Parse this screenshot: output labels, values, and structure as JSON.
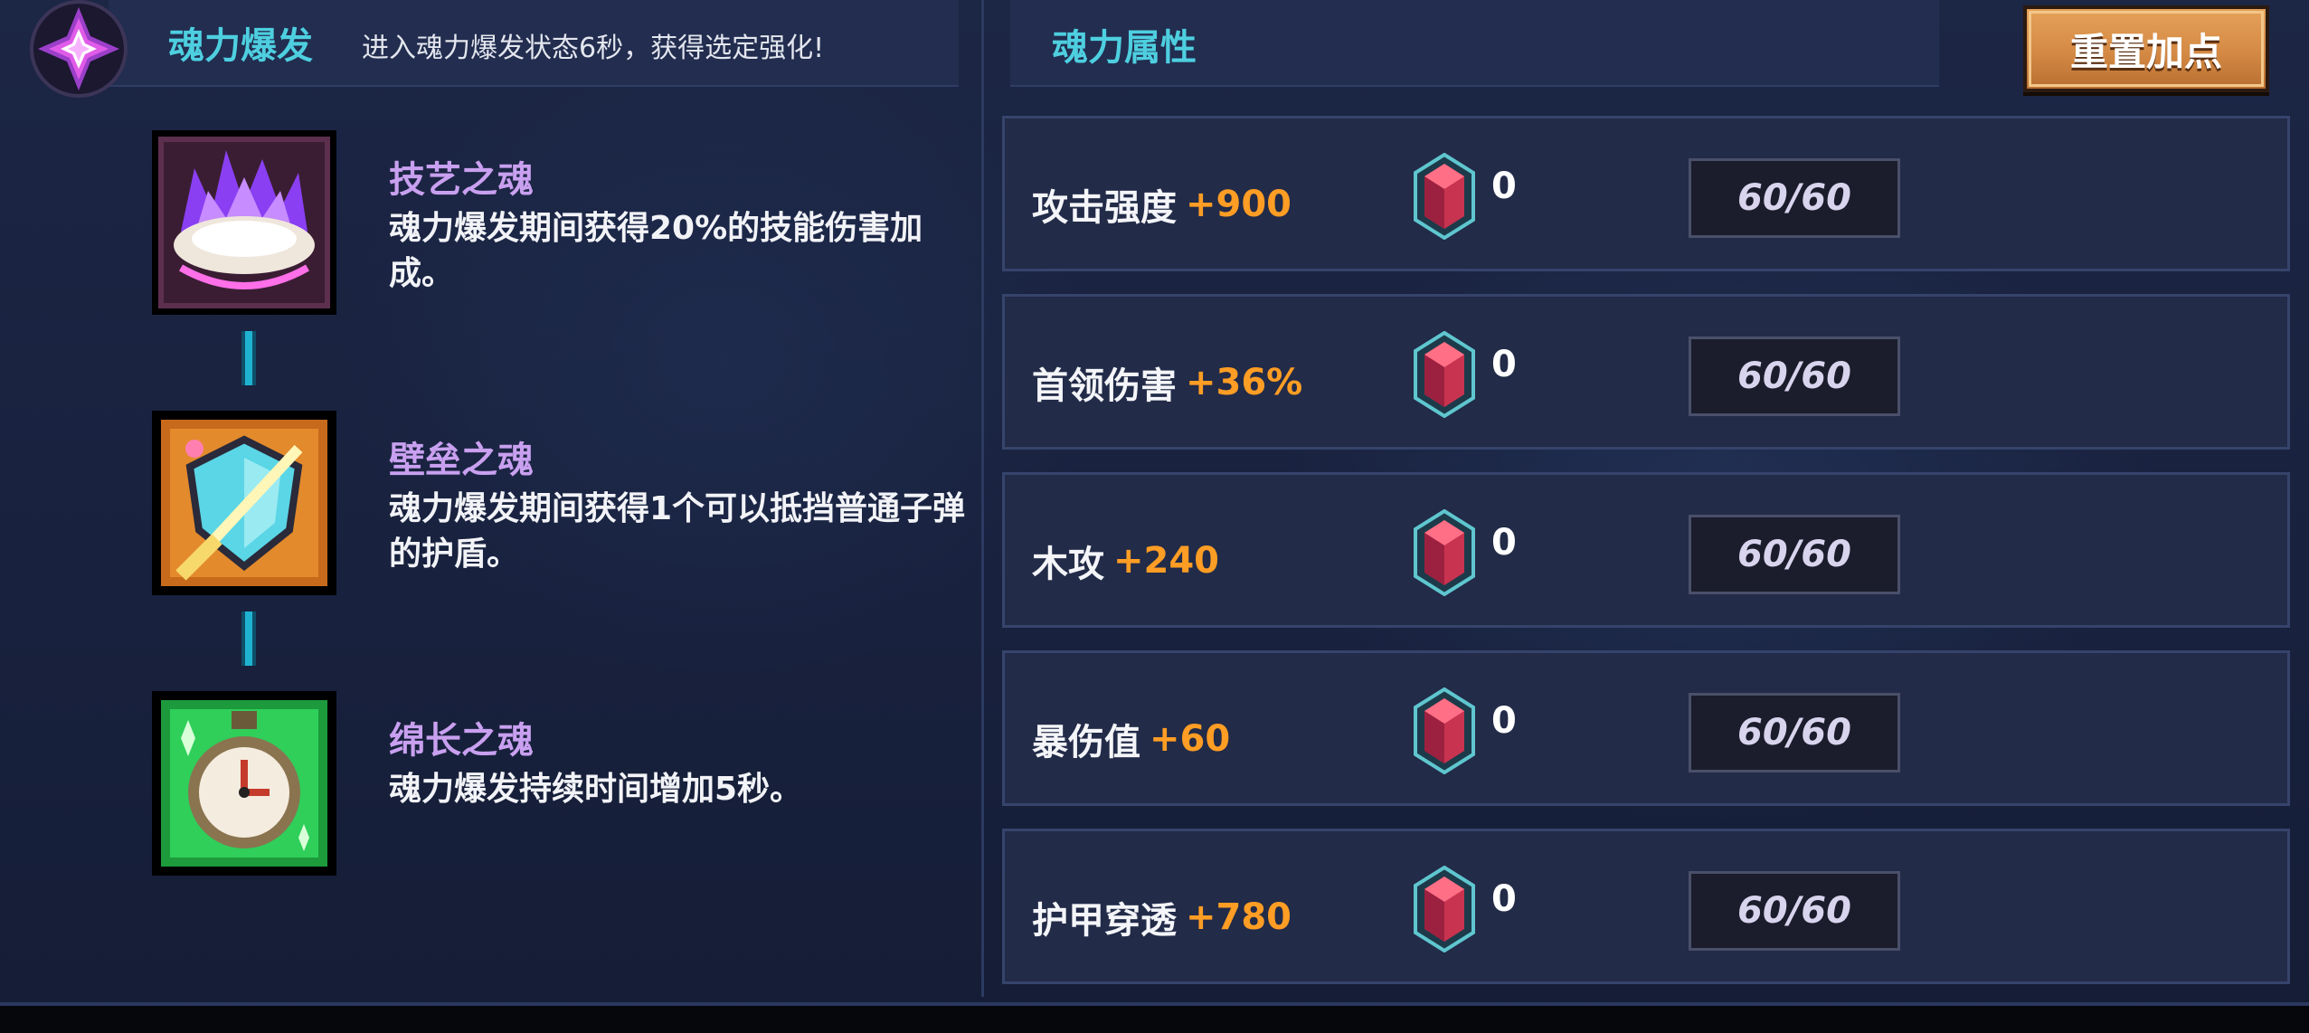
{
  "burst": {
    "icon": "soul-burst-crystal-icon",
    "title": "魂力爆发",
    "description": "进入魂力爆发状态6秒，获得选定强化!"
  },
  "souls": [
    {
      "name": "技艺之魂",
      "description": "魂力爆发期间获得20%的技能伤害加成。",
      "icon": "purple-flame-icon"
    },
    {
      "name": "壁垒之魂",
      "description": "魂力爆发期间获得1个可以抵挡普通子弹的护盾。",
      "icon": "shield-icon"
    },
    {
      "name": "绵长之魂",
      "description": "魂力爆发持续时间增加5秒。",
      "icon": "stopwatch-icon"
    }
  ],
  "attributes": {
    "title": "魂力属性",
    "reset_label": "重置加点",
    "rows": [
      {
        "name": "攻击强度",
        "value": "+900",
        "gems": "0",
        "progress": "60/60"
      },
      {
        "name": "首领伤害",
        "value": "+36%",
        "gems": "0",
        "progress": "60/60"
      },
      {
        "name": "木攻",
        "value": "+240",
        "gems": "0",
        "progress": "60/60"
      },
      {
        "name": "暴伤值",
        "value": "+60",
        "gems": "0",
        "progress": "60/60"
      },
      {
        "name": "护甲穿透",
        "value": "+780",
        "gems": "0",
        "progress": "60/60"
      }
    ]
  },
  "colors": {
    "accent": "#4ecfe0",
    "soul_name": "#c9a0f0",
    "stat_value": "#ff9d24",
    "reset_button": "#d48a44"
  }
}
